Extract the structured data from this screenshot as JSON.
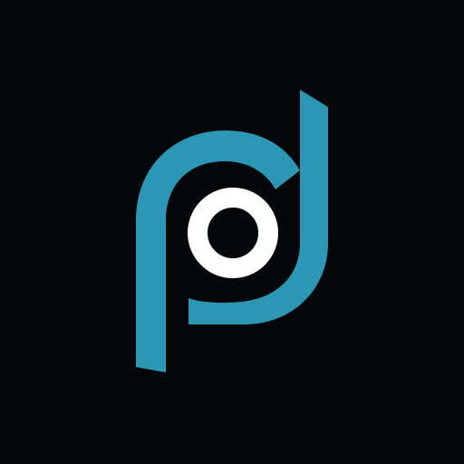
{
  "app_icon": {
    "background_color": "#030709",
    "mark_color": "#2b97b5",
    "ring_color": "#ffffff",
    "icon_names": [
      "pd-monogram-logo-icon",
      "white-ring-icon"
    ]
  }
}
